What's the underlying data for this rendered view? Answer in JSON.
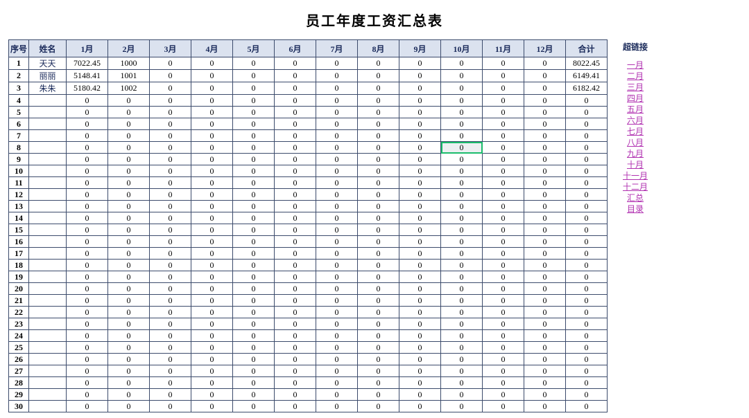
{
  "title": "员工年度工资汇总表",
  "header": {
    "seq": "序号",
    "name": "姓名",
    "months": [
      "1月",
      "2月",
      "3月",
      "4月",
      "5月",
      "6月",
      "7月",
      "8月",
      "9月",
      "10月",
      "11月",
      "12月"
    ],
    "sum": "合计"
  },
  "selected_cell": {
    "row": 8,
    "month_index": 9
  },
  "rows": [
    {
      "seq": 1,
      "name": "天天",
      "months": [
        "7022.45",
        "1000",
        "0",
        "0",
        "0",
        "0",
        "0",
        "0",
        "0",
        "0",
        "0",
        "0"
      ],
      "sum": "8022.45"
    },
    {
      "seq": 2,
      "name": "丽丽",
      "months": [
        "5148.41",
        "1001",
        "0",
        "0",
        "0",
        "0",
        "0",
        "0",
        "0",
        "0",
        "0",
        "0"
      ],
      "sum": "6149.41"
    },
    {
      "seq": 3,
      "name": "朱朱",
      "months": [
        "5180.42",
        "1002",
        "0",
        "0",
        "0",
        "0",
        "0",
        "0",
        "0",
        "0",
        "0",
        "0"
      ],
      "sum": "6182.42"
    },
    {
      "seq": 4,
      "name": "",
      "months": [
        "0",
        "0",
        "0",
        "0",
        "0",
        "0",
        "0",
        "0",
        "0",
        "0",
        "0",
        "0"
      ],
      "sum": "0"
    },
    {
      "seq": 5,
      "name": "",
      "months": [
        "0",
        "0",
        "0",
        "0",
        "0",
        "0",
        "0",
        "0",
        "0",
        "0",
        "0",
        "0"
      ],
      "sum": "0"
    },
    {
      "seq": 6,
      "name": "",
      "months": [
        "0",
        "0",
        "0",
        "0",
        "0",
        "0",
        "0",
        "0",
        "0",
        "0",
        "0",
        "0"
      ],
      "sum": "0"
    },
    {
      "seq": 7,
      "name": "",
      "months": [
        "0",
        "0",
        "0",
        "0",
        "0",
        "0",
        "0",
        "0",
        "0",
        "0",
        "0",
        "0"
      ],
      "sum": "0"
    },
    {
      "seq": 8,
      "name": "",
      "months": [
        "0",
        "0",
        "0",
        "0",
        "0",
        "0",
        "0",
        "0",
        "0",
        "0",
        "0",
        "0"
      ],
      "sum": "0"
    },
    {
      "seq": 9,
      "name": "",
      "months": [
        "0",
        "0",
        "0",
        "0",
        "0",
        "0",
        "0",
        "0",
        "0",
        "0",
        "0",
        "0"
      ],
      "sum": "0"
    },
    {
      "seq": 10,
      "name": "",
      "months": [
        "0",
        "0",
        "0",
        "0",
        "0",
        "0",
        "0",
        "0",
        "0",
        "0",
        "0",
        "0"
      ],
      "sum": "0"
    },
    {
      "seq": 11,
      "name": "",
      "months": [
        "0",
        "0",
        "0",
        "0",
        "0",
        "0",
        "0",
        "0",
        "0",
        "0",
        "0",
        "0"
      ],
      "sum": "0"
    },
    {
      "seq": 12,
      "name": "",
      "months": [
        "0",
        "0",
        "0",
        "0",
        "0",
        "0",
        "0",
        "0",
        "0",
        "0",
        "0",
        "0"
      ],
      "sum": "0"
    },
    {
      "seq": 13,
      "name": "",
      "months": [
        "0",
        "0",
        "0",
        "0",
        "0",
        "0",
        "0",
        "0",
        "0",
        "0",
        "0",
        "0"
      ],
      "sum": "0"
    },
    {
      "seq": 14,
      "name": "",
      "months": [
        "0",
        "0",
        "0",
        "0",
        "0",
        "0",
        "0",
        "0",
        "0",
        "0",
        "0",
        "0"
      ],
      "sum": "0"
    },
    {
      "seq": 15,
      "name": "",
      "months": [
        "0",
        "0",
        "0",
        "0",
        "0",
        "0",
        "0",
        "0",
        "0",
        "0",
        "0",
        "0"
      ],
      "sum": "0"
    },
    {
      "seq": 16,
      "name": "",
      "months": [
        "0",
        "0",
        "0",
        "0",
        "0",
        "0",
        "0",
        "0",
        "0",
        "0",
        "0",
        "0"
      ],
      "sum": "0"
    },
    {
      "seq": 17,
      "name": "",
      "months": [
        "0",
        "0",
        "0",
        "0",
        "0",
        "0",
        "0",
        "0",
        "0",
        "0",
        "0",
        "0"
      ],
      "sum": "0"
    },
    {
      "seq": 18,
      "name": "",
      "months": [
        "0",
        "0",
        "0",
        "0",
        "0",
        "0",
        "0",
        "0",
        "0",
        "0",
        "0",
        "0"
      ],
      "sum": "0"
    },
    {
      "seq": 19,
      "name": "",
      "months": [
        "0",
        "0",
        "0",
        "0",
        "0",
        "0",
        "0",
        "0",
        "0",
        "0",
        "0",
        "0"
      ],
      "sum": "0"
    },
    {
      "seq": 20,
      "name": "",
      "months": [
        "0",
        "0",
        "0",
        "0",
        "0",
        "0",
        "0",
        "0",
        "0",
        "0",
        "0",
        "0"
      ],
      "sum": "0"
    },
    {
      "seq": 21,
      "name": "",
      "months": [
        "0",
        "0",
        "0",
        "0",
        "0",
        "0",
        "0",
        "0",
        "0",
        "0",
        "0",
        "0"
      ],
      "sum": "0"
    },
    {
      "seq": 22,
      "name": "",
      "months": [
        "0",
        "0",
        "0",
        "0",
        "0",
        "0",
        "0",
        "0",
        "0",
        "0",
        "0",
        "0"
      ],
      "sum": "0"
    },
    {
      "seq": 23,
      "name": "",
      "months": [
        "0",
        "0",
        "0",
        "0",
        "0",
        "0",
        "0",
        "0",
        "0",
        "0",
        "0",
        "0"
      ],
      "sum": "0"
    },
    {
      "seq": 24,
      "name": "",
      "months": [
        "0",
        "0",
        "0",
        "0",
        "0",
        "0",
        "0",
        "0",
        "0",
        "0",
        "0",
        "0"
      ],
      "sum": "0"
    },
    {
      "seq": 25,
      "name": "",
      "months": [
        "0",
        "0",
        "0",
        "0",
        "0",
        "0",
        "0",
        "0",
        "0",
        "0",
        "0",
        "0"
      ],
      "sum": "0"
    },
    {
      "seq": 26,
      "name": "",
      "months": [
        "0",
        "0",
        "0",
        "0",
        "0",
        "0",
        "0",
        "0",
        "0",
        "0",
        "0",
        "0"
      ],
      "sum": "0"
    },
    {
      "seq": 27,
      "name": "",
      "months": [
        "0",
        "0",
        "0",
        "0",
        "0",
        "0",
        "0",
        "0",
        "0",
        "0",
        "0",
        "0"
      ],
      "sum": "0"
    },
    {
      "seq": 28,
      "name": "",
      "months": [
        "0",
        "0",
        "0",
        "0",
        "0",
        "0",
        "0",
        "0",
        "0",
        "0",
        "0",
        "0"
      ],
      "sum": "0"
    },
    {
      "seq": 29,
      "name": "",
      "months": [
        "0",
        "0",
        "0",
        "0",
        "0",
        "0",
        "0",
        "0",
        "0",
        "0",
        "0",
        "0"
      ],
      "sum": "0"
    },
    {
      "seq": 30,
      "name": "",
      "months": [
        "0",
        "0",
        "0",
        "0",
        "0",
        "0",
        "0",
        "0",
        "0",
        "0",
        "0",
        "0"
      ],
      "sum": "0"
    }
  ],
  "links_header": "超链接",
  "links": [
    "一月",
    "二月",
    "三月",
    "四月",
    "五月",
    "六月",
    "七月",
    "八月",
    "九月",
    "十月",
    "十一月",
    "十二月",
    "汇总",
    "目录"
  ]
}
